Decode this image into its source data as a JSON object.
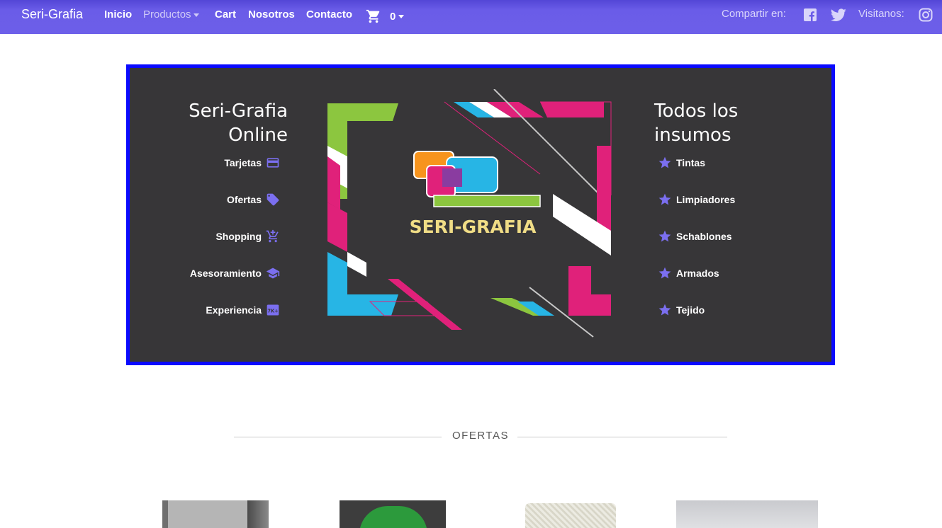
{
  "nav": {
    "brand": "Seri-Grafia",
    "items": [
      "Inicio",
      "Productos",
      "Cart",
      "Nosotros",
      "Contacto"
    ],
    "cart_count": "0",
    "share_label": "Compartir en:",
    "visit_label": "Visitanos:"
  },
  "hero": {
    "left_title_line1": "Seri-Grafia",
    "left_title_line2": "Online",
    "left_items": [
      {
        "label": "Tarjetas",
        "icon": "credit-card-icon"
      },
      {
        "label": "Ofertas",
        "icon": "tag-icon"
      },
      {
        "label": "Shopping",
        "icon": "cart-plus-icon"
      },
      {
        "label": "Asesoramiento",
        "icon": "graduation-cap-icon"
      },
      {
        "label": "Experiencia",
        "icon": "7k-icon"
      }
    ],
    "logo_text": "SERI-GRAFIA",
    "right_title_line1": "Todos los",
    "right_title_line2": "insumos",
    "right_items": [
      {
        "label": "Tintas",
        "icon": "star-icon"
      },
      {
        "label": "Limpiadores",
        "icon": "star-icon"
      },
      {
        "label": "Schablones",
        "icon": "star-icon"
      },
      {
        "label": "Armados",
        "icon": "star-icon"
      },
      {
        "label": "Tejido",
        "icon": "star-icon"
      }
    ],
    "icon_color": "#7b6ff0"
  },
  "section": {
    "ofertas_label": "OFERTAS"
  },
  "colors": {
    "navbar": "#6a5ce8",
    "hero_border": "#0a0aff",
    "hero_bg": "#373638",
    "accent_green": "#8cc63f",
    "accent_pink": "#e0217a",
    "accent_cyan": "#27b5e5",
    "logo_text": "#f0dd86"
  }
}
